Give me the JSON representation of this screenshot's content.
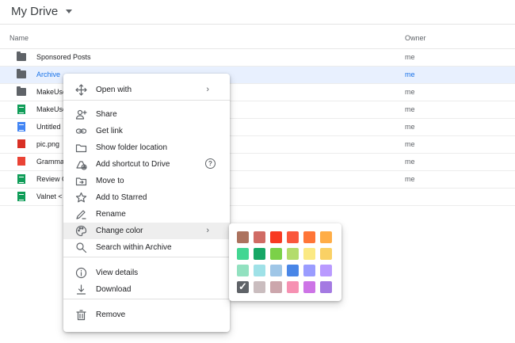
{
  "header": {
    "title": "My Drive"
  },
  "columns": {
    "name": "Name",
    "owner": "Owner"
  },
  "files": [
    {
      "name": "Sponsored Posts",
      "owner": "me",
      "type": "folder"
    },
    {
      "name": "Archive",
      "owner": "me",
      "type": "folder",
      "selected": true
    },
    {
      "name": "MakeUse",
      "owner": "me",
      "type": "folder"
    },
    {
      "name": "MakeUse",
      "owner": "me",
      "type": "sheet"
    },
    {
      "name": "Untitled",
      "owner": "me",
      "type": "doc"
    },
    {
      "name": "pic.png",
      "owner": "me",
      "type": "image"
    },
    {
      "name": "Gramma",
      "owner": "me",
      "type": "pdf"
    },
    {
      "name": "Review C",
      "owner": "me",
      "type": "sheet"
    },
    {
      "name": "Valnet <",
      "owner": "",
      "type": "sheet"
    }
  ],
  "context_menu": {
    "items": [
      {
        "label": "Open with",
        "icon": "move-icon",
        "submenu": true
      },
      {
        "label": "Share",
        "icon": "person-add-icon"
      },
      {
        "label": "Get link",
        "icon": "link-icon"
      },
      {
        "label": "Show folder location",
        "icon": "folder-icon"
      },
      {
        "label": "Add shortcut to Drive",
        "icon": "add-shortcut-icon",
        "help": true
      },
      {
        "label": "Move to",
        "icon": "move-to-folder-icon"
      },
      {
        "label": "Add to Starred",
        "icon": "star-icon"
      },
      {
        "label": "Rename",
        "icon": "pencil-icon"
      },
      {
        "label": "Change color",
        "icon": "palette-icon",
        "submenu": true,
        "highlighted": true
      },
      {
        "label": "Search within Archive",
        "icon": "search-icon"
      },
      {
        "label": "View details",
        "icon": "info-icon"
      },
      {
        "label": "Download",
        "icon": "download-icon"
      },
      {
        "label": "Remove",
        "icon": "trash-icon"
      }
    ],
    "help_glyph": "?",
    "arrow_glyph": "›"
  },
  "palette": {
    "colors": [
      [
        "#ac725e",
        "#d06b64",
        "#f83a22",
        "#fa573c",
        "#ff7537",
        "#ffad46"
      ],
      [
        "#42d692",
        "#16a765",
        "#7bd148",
        "#b3dc6c",
        "#fbe983",
        "#fad165"
      ],
      [
        "#92e1c0",
        "#9fe1e7",
        "#9fc6e7",
        "#4986e7",
        "#9a9cff",
        "#b99aff"
      ],
      [
        "#8f8f8f",
        "#cabdbf",
        "#cca6ac",
        "#f691b2",
        "#cd74e6",
        "#a47ae2"
      ]
    ],
    "selected": [
      3,
      0
    ]
  }
}
